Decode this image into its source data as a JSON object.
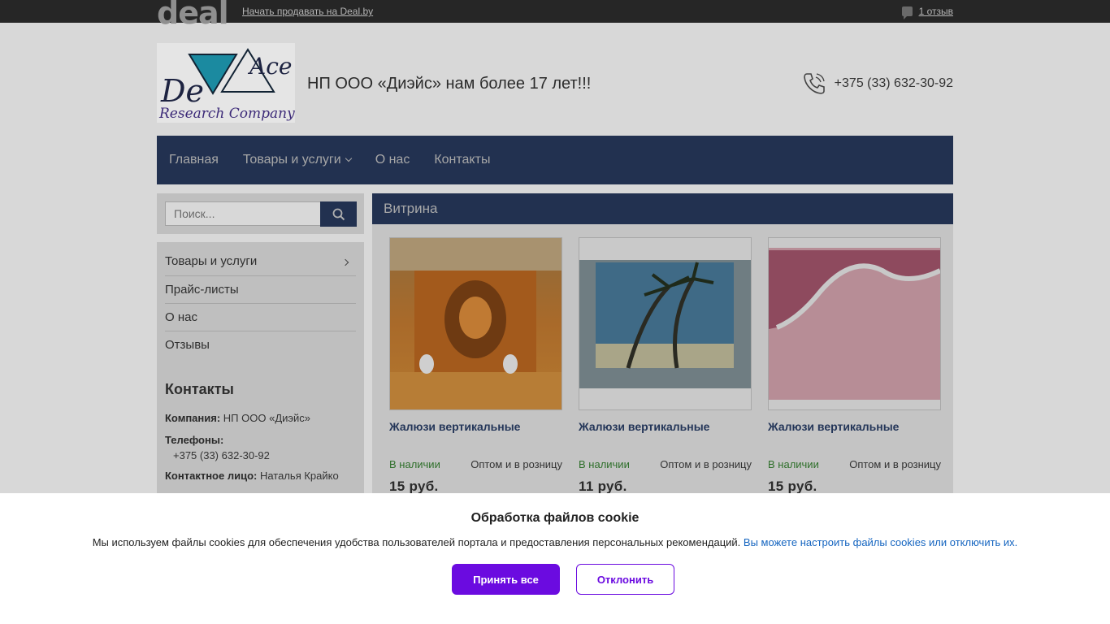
{
  "topbar": {
    "logo_text": "deal",
    "sell_link": "Начать продавать на Deal.by",
    "reviews_link": "1 отзыв"
  },
  "header": {
    "logo_alt": "DeAce Research Company",
    "logo_lines": [
      "De",
      "Ace",
      "Research Company"
    ],
    "slogan": "НП ООО «Диэйс» нам более 17 лет!!!",
    "phone": "+375 (33) 632-30-92"
  },
  "nav": {
    "items": [
      {
        "label": "Главная"
      },
      {
        "label": "Товары и услуги",
        "has_dropdown": true
      },
      {
        "label": "О нас"
      },
      {
        "label": "Контакты"
      }
    ]
  },
  "search": {
    "placeholder": "Поиск..."
  },
  "sidebar": {
    "menu": [
      {
        "label": "Товары и услуги",
        "has_submenu": true
      },
      {
        "label": "Прайс-листы"
      },
      {
        "label": "О нас"
      },
      {
        "label": "Отзывы"
      }
    ],
    "contacts_title": "Контакты",
    "company_label": "Компания:",
    "company_value": "НП ООО «Диэйс»",
    "phones_label": "Телефоны:",
    "phones_value": "+375 (33) 632-30-92",
    "person_label": "Контактное лицо:",
    "person_value": "Наталья Крайко"
  },
  "vitrina": {
    "title": "Витрина",
    "products": [
      {
        "name": "Жалюзи вертикальные",
        "stock": "В наличии",
        "sale": "Оптом и в розницу",
        "price": "15 руб."
      },
      {
        "name": "Жалюзи вертикальные",
        "stock": "В наличии",
        "sale": "Оптом и в розницу",
        "price": "11 руб."
      },
      {
        "name": "Жалюзи вертикальные",
        "stock": "В наличии",
        "sale": "Оптом и в розницу",
        "price": "15 руб."
      }
    ]
  },
  "cookie": {
    "title": "Обработка файлов cookie",
    "text": "Мы используем файлы cookies для обеспечения удобства пользователей портала и предоставления персональных рекомендаций.",
    "link": "Вы можете настроить файлы cookies или отключить их.",
    "accept": "Принять все",
    "decline": "Отклонить"
  },
  "colors": {
    "nav_bg": "#223150",
    "accent_purple": "#6b0be0",
    "stock_green": "#2e6f2a",
    "link_blue": "#1565c0"
  }
}
